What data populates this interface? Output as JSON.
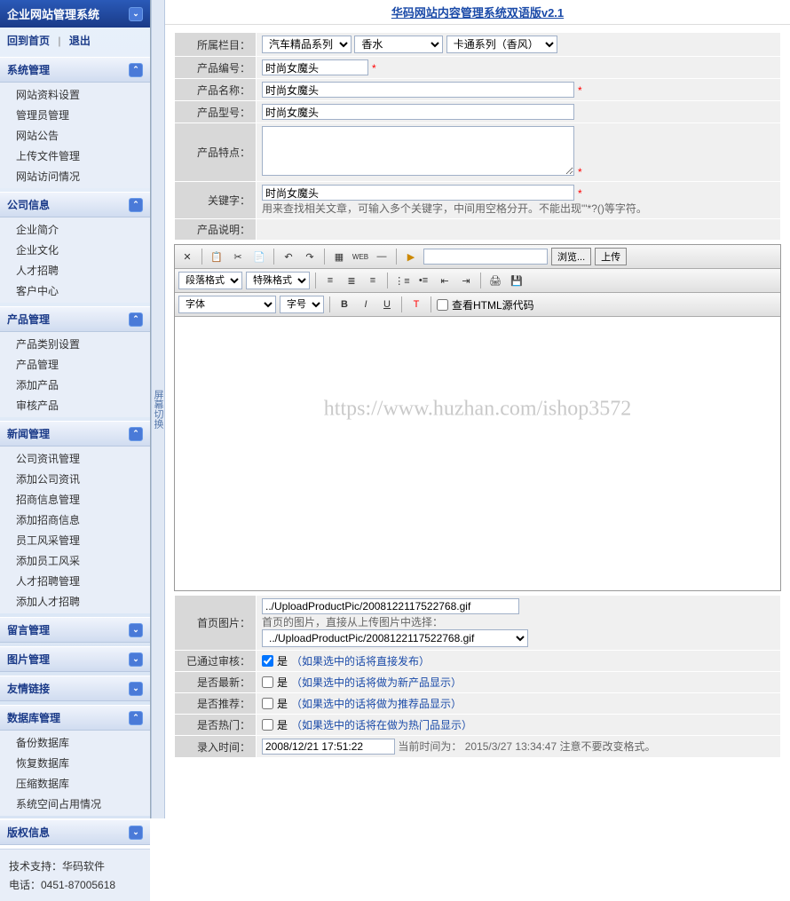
{
  "sidebar": {
    "title": "企业网站管理系统",
    "home": "回到首页",
    "logout": "退出",
    "sections": [
      {
        "title": "系统管理",
        "items": [
          "网站资料设置",
          "管理员管理",
          "网站公告",
          "上传文件管理",
          "网站访问情况"
        ]
      },
      {
        "title": "公司信息",
        "items": [
          "企业简介",
          "企业文化",
          "人才招聘",
          "客户中心"
        ]
      },
      {
        "title": "产品管理",
        "items": [
          "产品类别设置",
          "产品管理",
          "添加产品",
          "审核产品"
        ]
      },
      {
        "title": "新闻管理",
        "items": [
          "公司资讯管理",
          "添加公司资讯",
          "招商信息管理",
          "添加招商信息",
          "员工风采管理",
          "添加员工风采",
          "人才招聘管理",
          "添加人才招聘"
        ]
      },
      {
        "title": "留言管理",
        "items": []
      },
      {
        "title": "图片管理",
        "items": []
      },
      {
        "title": "友情链接",
        "items": []
      },
      {
        "title": "数据库管理",
        "items": [
          "备份数据库",
          "恢复数据库",
          "压缩数据库",
          "系统空间占用情况"
        ]
      },
      {
        "title": "版权信息",
        "items": []
      }
    ],
    "footer": {
      "line1": "技术支持：华码软件",
      "line2": "电话：0451-87005618"
    }
  },
  "strip": "屏幕切换",
  "main": {
    "title": "华码网站内容管理系统双语版v2.1",
    "labels": {
      "category": "所属栏目：",
      "code": "产品编号：",
      "name": "产品名称：",
      "model": "产品型号：",
      "feature": "产品特点：",
      "keyword": "关键字：",
      "desc": "产品说明：",
      "homepic": "首页图片：",
      "audited": "已通过审核：",
      "newest": "是否最新：",
      "recommend": "是否推荐：",
      "hot": "是否热门：",
      "entrytime": "录入时间："
    },
    "cat1": "汽车精品系列",
    "cat2": "香水",
    "cat3": "卡通系列（香风）",
    "code_val": "时尚女魔头",
    "name_val": "时尚女魔头",
    "model_val": "时尚女魔头",
    "feature_val": "",
    "keyword_val": "时尚女魔头",
    "keyword_hint": "用来查找相关文章，可输入多个关键字，中间用空格分开。不能出现\"'*?()等字符。",
    "homepic_val": "../UploadProductPic/2008122117522768.gif",
    "homepic_hint": "首页的图片，直接从上传图片中选择：",
    "homepic_sel": "../UploadProductPic/2008122117522768.gif",
    "yes": "是",
    "audit_hint": "（如果选中的话将直接发布）",
    "newest_hint": "（如果选中的话将做为新产品显示）",
    "recommend_hint": "（如果选中的话将做为推荐品显示）",
    "hot_hint": "（如果选中的话将在做为热门品显示）",
    "entrytime_val": "2008/12/21 17:51:22",
    "now_label": "当前时间为：",
    "now_val": "2015/3/27 13:34:47",
    "now_hint": "注意不要改变格式。",
    "editor": {
      "para": "段落格式",
      "special": "特殊格式",
      "font": "字体",
      "size": "字号",
      "browse": "浏览...",
      "upload": "上传",
      "viewsrc": "查看HTML源代码"
    }
  },
  "watermark": "https://www.huzhan.com/ishop3572"
}
